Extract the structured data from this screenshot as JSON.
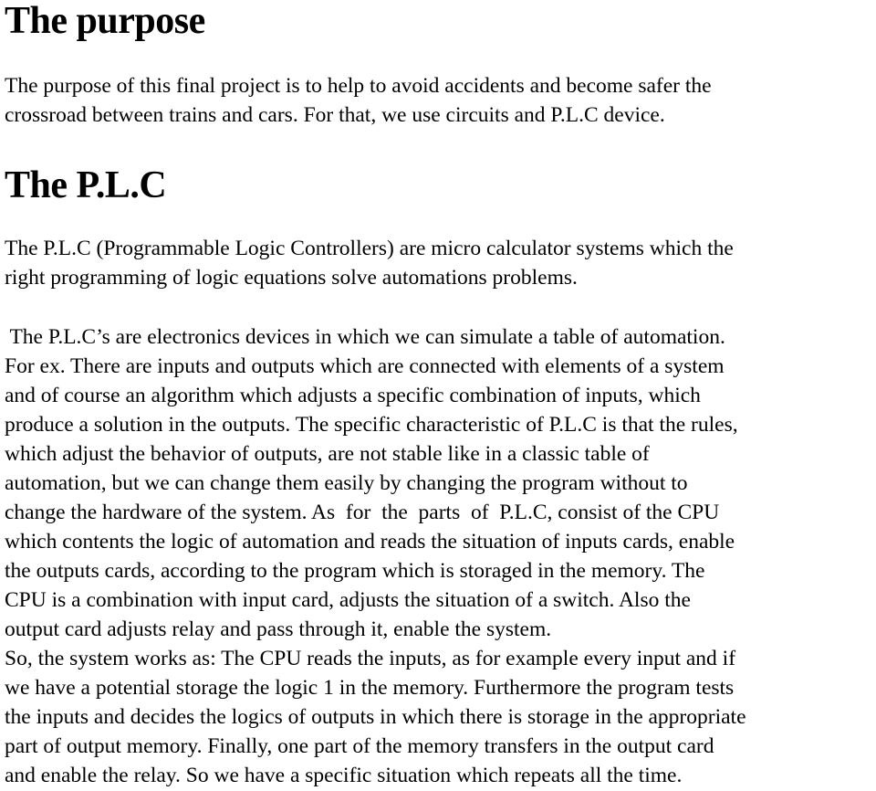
{
  "sections": [
    {
      "heading": "The purpose",
      "paragraphs": [
        {
          "lines": [
            "The purpose of this final project is to help to avoid accidents and become safer the",
            "crossroad between trains and cars. For that, we use circuits and P.L.C device."
          ]
        }
      ]
    },
    {
      "heading": "The P.L.C",
      "paragraphs": [
        {
          "lines": [
            "The P.L.C (Programmable Logic Controllers) are micro calculator systems which the",
            "right programming of logic equations solve automations problems."
          ]
        },
        {
          "lines": [
            " The P.L.C’s are electronics devices in which we can simulate a table of automation.",
            "For ex. There are inputs and outputs which are connected with elements of a system",
            "and of course an algorithm which adjusts a specific combination of inputs, which",
            "produce a solution in the outputs. The specific characteristic of P.L.C is that the rules,",
            "which adjust the behavior of outputs, are not stable like in a classic table of",
            "automation, but we can change them easily by changing the program without to",
            "change the hardware of the system. As  for  the  parts  of  P.L.C, consist of the CPU",
            "which contents the logic of automation and reads the situation of inputs cards, enable",
            "the outputs cards, according to the program which is storaged in the memory. The",
            "CPU is a combination with input card, adjusts the situation of a switch. Also the",
            "output card adjusts relay and pass through it, enable the system.",
            "So, the system works as: The CPU reads the inputs, as for example every input and if",
            "we have a potential storage the logic 1 in the memory. Furthermore the program tests",
            "the inputs and decides the logics of outputs in which there is storage in the appropriate",
            "part of output memory. Finally, one part of the memory transfers in the output card",
            "and enable the relay. So we have a specific situation which repeats all the time."
          ]
        }
      ]
    }
  ]
}
